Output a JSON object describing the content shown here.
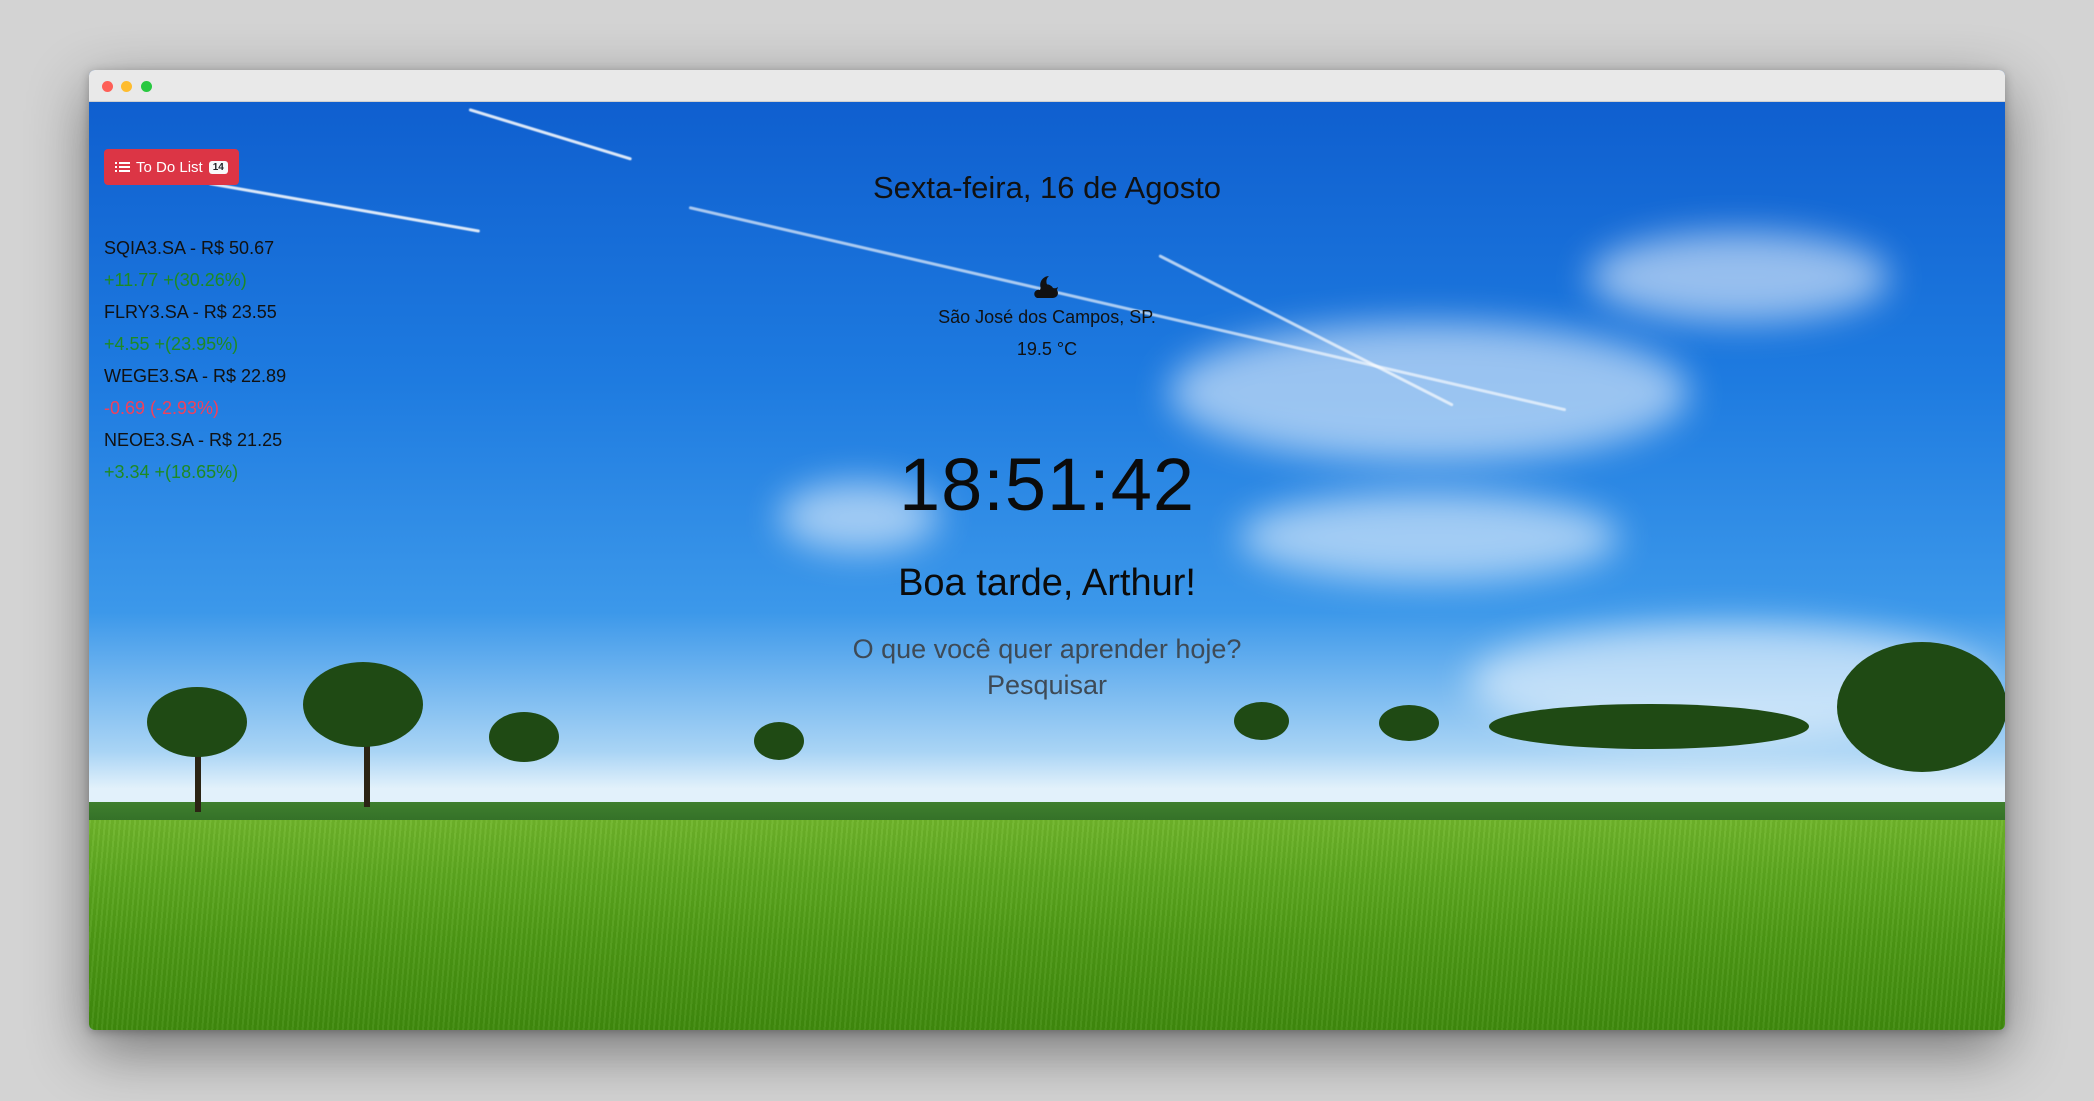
{
  "todo": {
    "label": "To Do List",
    "count": "14"
  },
  "stocks": [
    {
      "name": "SQIA3.SA - R$ 50.67",
      "change": "+11.77 +(30.26%)",
      "direction": "up"
    },
    {
      "name": "FLRY3.SA - R$ 23.55",
      "change": "+4.55 +(23.95%)",
      "direction": "up"
    },
    {
      "name": "WEGE3.SA - R$ 22.89",
      "change": "-0.69 (-2.93%)",
      "direction": "down"
    },
    {
      "name": "NEOE3.SA - R$ 21.25",
      "change": "+3.34 +(18.65%)",
      "direction": "up"
    }
  ],
  "date": "Sexta-feira, 16 de Agosto",
  "weather": {
    "icon": "cloud-moon-icon",
    "city": "São José dos Campos, SP.",
    "temperature": "19.5 °C"
  },
  "clock": "18:51:42",
  "greeting": "Boa tarde, Arthur!",
  "prompt": "O que você quer aprender hoje?",
  "search_label": "Pesquisar",
  "colors": {
    "todo_button": "#dc3545",
    "up": "#1e8a23",
    "down": "#f2405a"
  }
}
